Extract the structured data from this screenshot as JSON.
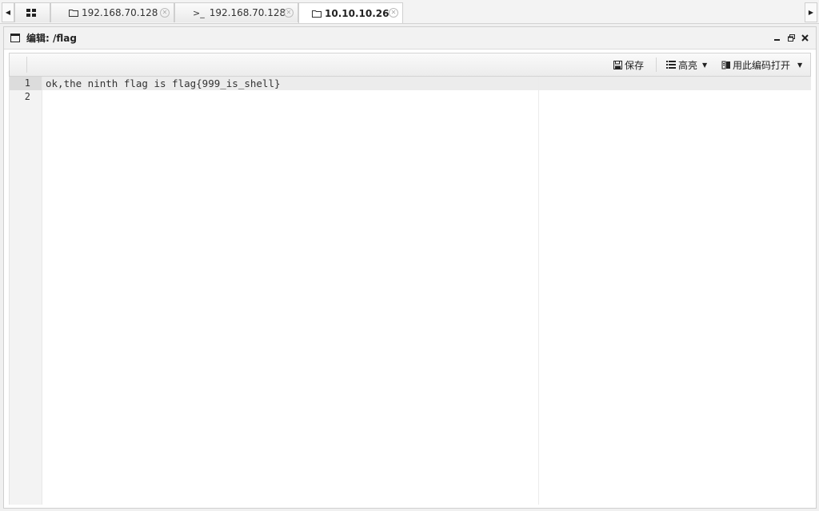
{
  "tabs": [
    {
      "label": "",
      "icon": "grid-icon"
    },
    {
      "label": "192.168.70.128",
      "icon": "folder-icon"
    },
    {
      "label": "192.168.70.128",
      "icon": "terminal-icon",
      "prefix": ">_"
    },
    {
      "label": "10.10.10.26",
      "icon": "folder-icon",
      "active": true
    }
  ],
  "window": {
    "title": "编辑: /flag"
  },
  "toolbar": {
    "save_label": "保存",
    "highlight_label": "高亮",
    "open_with_encoding_label": "用此编码打开"
  },
  "editor": {
    "line_numbers": [
      "1",
      "2"
    ],
    "lines": [
      "ok,the ninth flag is flag{999_is_shell}",
      ""
    ]
  },
  "colors": {
    "tab_bg": "#f3f3f3",
    "active_line": "#ececec",
    "gutter_bg": "#f3f3f3"
  }
}
